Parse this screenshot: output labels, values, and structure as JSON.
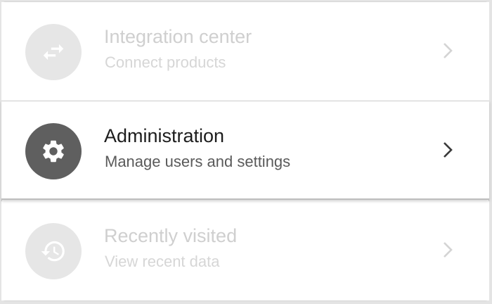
{
  "menu": {
    "items": [
      {
        "title": "Integration center",
        "subtitle": "Connect products",
        "icon": "swap-arrows-icon",
        "state": "disabled"
      },
      {
        "title": "Administration",
        "subtitle": "Manage users and settings",
        "icon": "gear-icon",
        "state": "active"
      },
      {
        "title": "Recently visited",
        "subtitle": "View recent data",
        "icon": "history-icon",
        "state": "disabled"
      }
    ]
  },
  "colors": {
    "active_icon_bg": "#5f5f5f",
    "disabled_icon_bg": "#e6e6e6",
    "disabled_text": "#cfcfcf"
  }
}
